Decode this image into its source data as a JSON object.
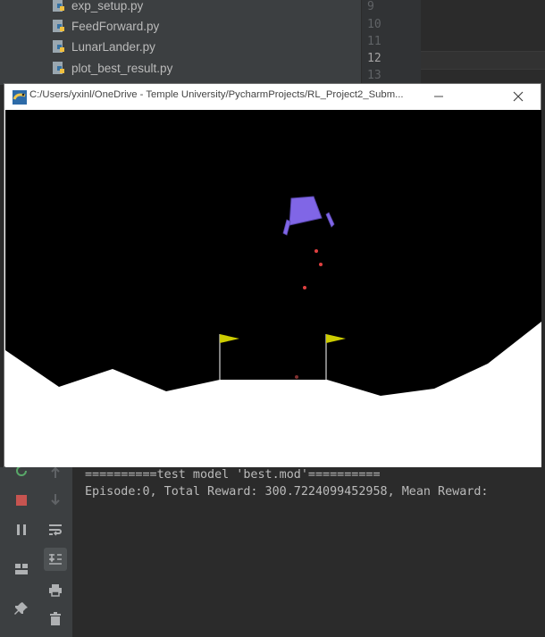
{
  "project_tree": {
    "files": [
      {
        "name": "exp_setup.py"
      },
      {
        "name": "FeedForward.py"
      },
      {
        "name": "LunarLander.py"
      },
      {
        "name": "plot_best_result.py"
      }
    ]
  },
  "editor": {
    "line_numbers": [
      "9",
      "10",
      "11",
      "12",
      "13"
    ],
    "current_line": "12"
  },
  "game_window": {
    "title": "C:/Users/yxinl/OneDrive - Temple University/PycharmProjects/RL_Project2_Subm...",
    "minimize_symbol": "—",
    "close_symbol": "✕"
  },
  "console": {
    "lines": [
      "==========test model 'best.mod'==========",
      "Episode:0, Total Reward: 300.7224099452958, Mean Reward:"
    ]
  },
  "colors": {
    "ide_background": "#2b2b2b",
    "lander": "#8066e6",
    "flag": "#cccc00",
    "terrain": "#ffffff",
    "particles": "#e04040",
    "stop_button": "#c75450"
  },
  "icons": {
    "run_toolbar": [
      "rerun-icon",
      "stop-icon",
      "pause-icon",
      "layout-icon",
      "pin-icon"
    ],
    "run_toolbar_secondary": [
      "up-arrow-icon",
      "down-arrow-icon",
      "soft-wrap-icon",
      "scroll-to-end-icon",
      "print-icon",
      "trash-icon"
    ]
  }
}
